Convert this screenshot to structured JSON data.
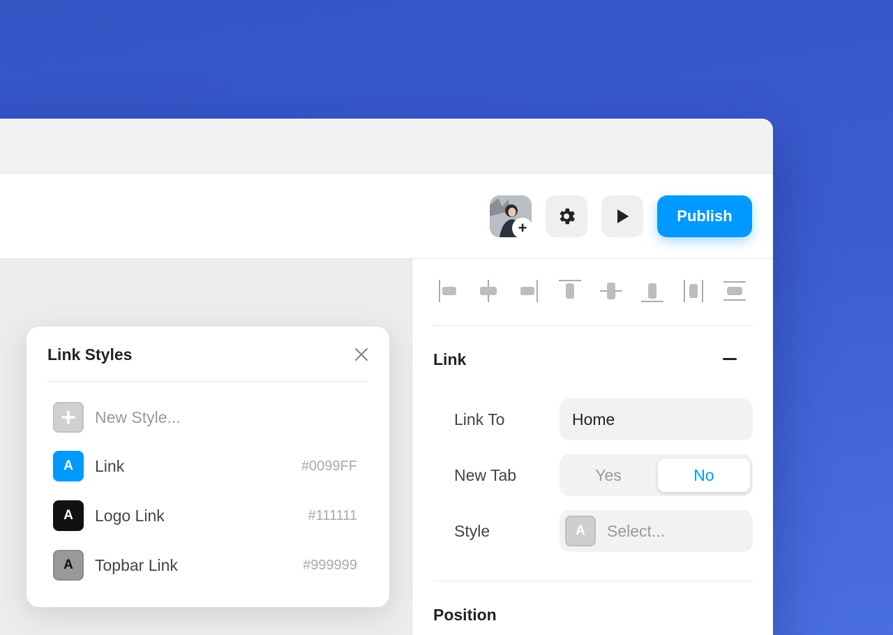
{
  "toolbar": {
    "publish_label": "Publish",
    "accent_color": "#0099FF",
    "icons": [
      "avatar",
      "plus-icon",
      "gear-icon",
      "play-icon"
    ]
  },
  "panel": {
    "alignment_icons": [
      "align-left-icon",
      "align-center-h-icon",
      "align-right-icon",
      "align-top-icon",
      "align-middle-v-icon",
      "align-bottom-icon",
      "distribute-h-icon",
      "distribute-v-icon"
    ],
    "link_section": {
      "title": "Link",
      "link_to_label": "Link To",
      "link_to_value": "Home",
      "new_tab_label": "New Tab",
      "new_tab_options": [
        "Yes",
        "No"
      ],
      "new_tab_selected": "No",
      "style_label": "Style",
      "style_swatch_letter": "A",
      "style_placeholder": "Select..."
    },
    "position_section": {
      "title": "Position"
    }
  },
  "popup": {
    "title": "Link Styles",
    "new_style_label": "New Style...",
    "items": [
      {
        "letter": "A",
        "label": "Link",
        "hex": "#0099FF",
        "color": "#0099FF"
      },
      {
        "letter": "A",
        "label": "Logo Link",
        "hex": "#111111",
        "color": "#111111"
      },
      {
        "letter": "A",
        "label": "Topbar Link",
        "hex": "#999999",
        "color": "#999999"
      }
    ]
  }
}
